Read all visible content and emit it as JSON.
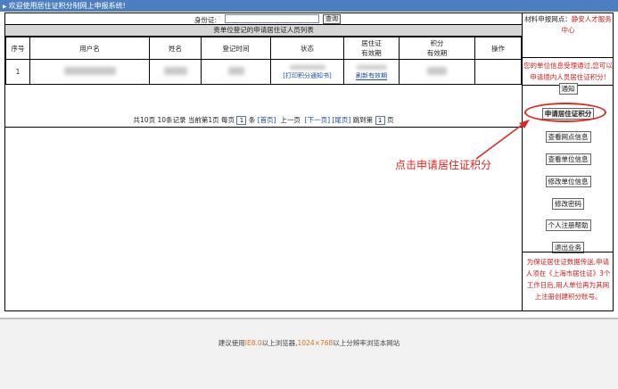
{
  "topbar": {
    "arrow": "▶",
    "welcome": "欢迎使用居住证积分制网上申报系统!"
  },
  "search": {
    "label": "身份证:",
    "value": "",
    "query_button": "查询"
  },
  "list": {
    "title": "贵单位登记的申请居住证人员列表",
    "headers": [
      "序号",
      "用户名",
      "姓名",
      "登记时间",
      "状态",
      "居住证\n有效期",
      "积分\n有效期",
      "操作"
    ],
    "rows": [
      {
        "index": "1",
        "status_link": "[打印积分通知书]",
        "permit_link": "刷新有效期"
      }
    ]
  },
  "pager": {
    "prefix": "共10页 10条记录 当前第1页 每页",
    "per_page": "1",
    "unit": "条",
    "first": "[首页]",
    "prev": "上一页",
    "next": "[下一页]",
    "last": "[尾页]",
    "jump": "跳到第",
    "jump_value": "1",
    "page": "页"
  },
  "sidebar": {
    "network_label": "材料申报网点：",
    "network_value": "静安人才服务中心",
    "notice_text": "您的单位信息受理通过,您可以申请境内人员居住证积分!",
    "buttons": [
      "通知",
      "申请居住证积分",
      "查看网点信息",
      "查看单位信息",
      "修改单位信息",
      "修改密码",
      "个人注册帮助",
      "退出业务"
    ],
    "bottom_note": "为保证居住证数据传送,申请人须在《上海市居住证》3个工作日后,用人单位再为其网上注册创建积分账号。"
  },
  "annotation": {
    "callout": "点击申请居住证积分"
  },
  "footer": {
    "prefix": "建议使用",
    "browser": "IE8.0",
    "mid": "以上浏览器,",
    "resolution": "1024×768",
    "suffix": "以上分辨率浏览本网站"
  },
  "colors": {
    "topbar": "#4c7ec0",
    "accent_red": "#e0281e",
    "link_blue": "#1848a8"
  }
}
